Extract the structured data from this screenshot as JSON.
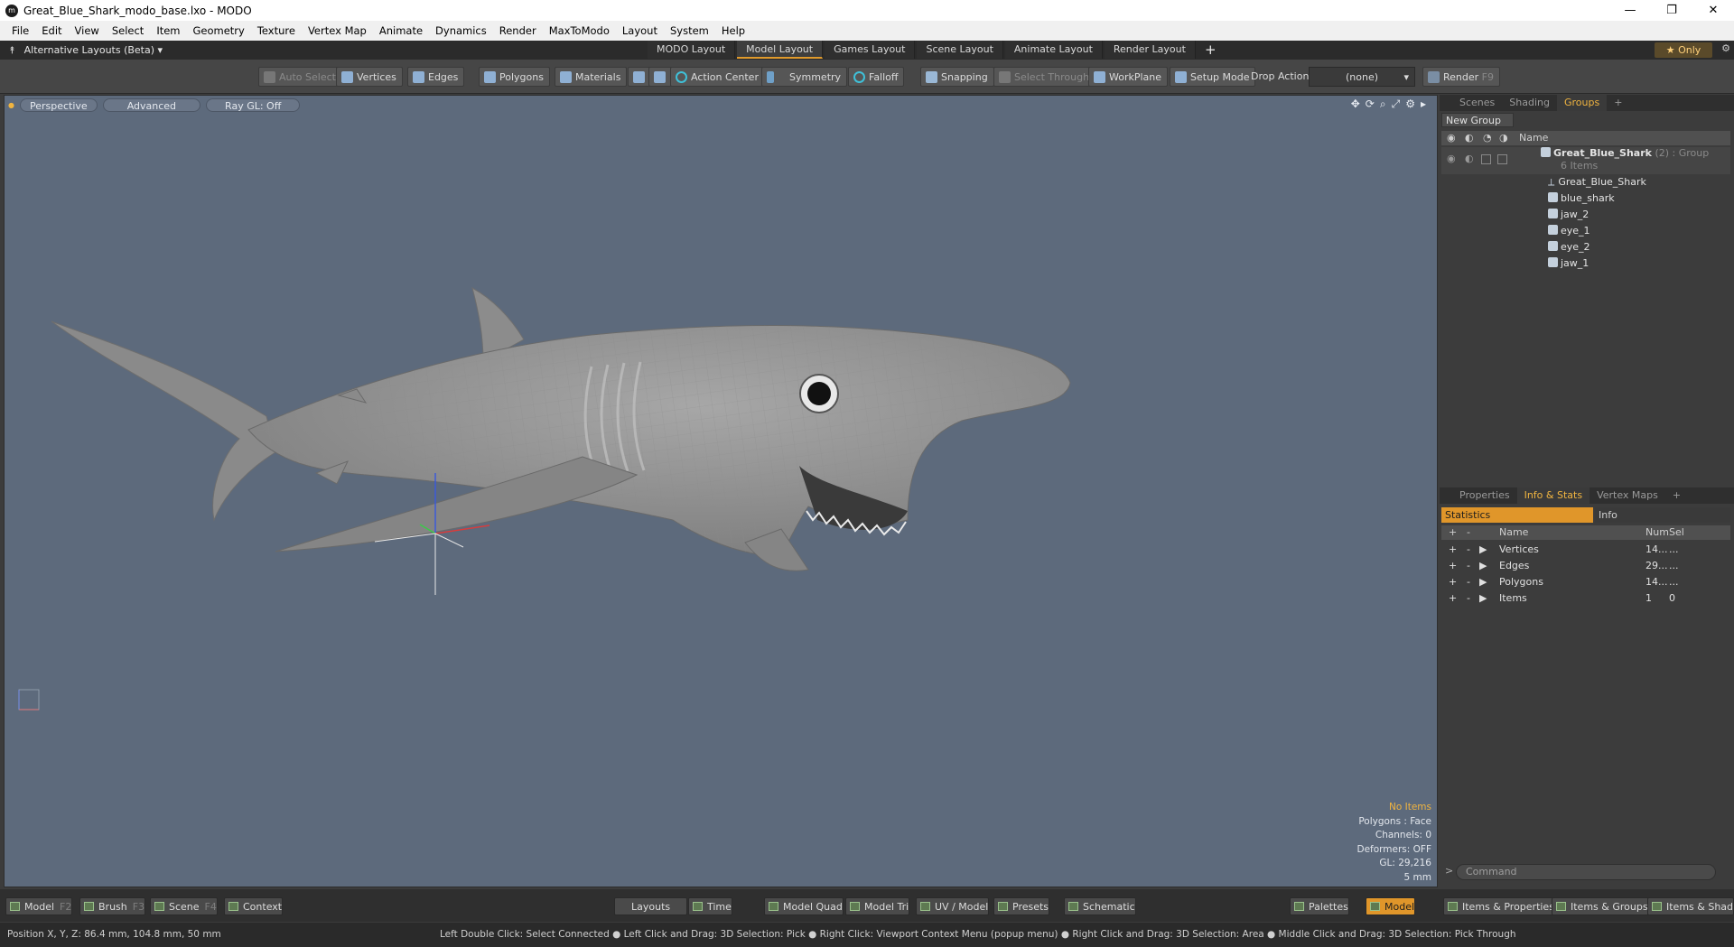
{
  "window": {
    "title": "Great_Blue_Shark_modo_base.lxo - MODO",
    "minimize": "—",
    "restore": "❐",
    "close": "✕"
  },
  "menu": [
    "File",
    "Edit",
    "View",
    "Select",
    "Item",
    "Geometry",
    "Texture",
    "Vertex Map",
    "Animate",
    "Dynamics",
    "Render",
    "MaxToModo",
    "Layout",
    "System",
    "Help"
  ],
  "layoutbar": {
    "alt_layouts": "Alternative Layouts (Beta)",
    "tabs": [
      "MODO Layout",
      "Model Layout",
      "Games Layout",
      "Scene Layout",
      "Animate Layout",
      "Render Layout"
    ],
    "active_tab": "Model Layout",
    "add": "+",
    "only": "★ Only"
  },
  "toolbar": {
    "auto_select": "Auto Select",
    "vertices": "Vertices",
    "edges": "Edges",
    "polygons": "Polygons",
    "materials": "Materials",
    "action_center": "Action Center",
    "symmetry": "Symmetry",
    "falloff": "Falloff",
    "snapping": "Snapping",
    "select_through": "Select Through",
    "workplane": "WorkPlane",
    "setup_mode": "Setup Mode",
    "drop_action_label": "Drop Action",
    "drop_action_value": "(none)",
    "render": "Render",
    "render_key": "F9"
  },
  "viewport": {
    "perspective": "Perspective",
    "advanced": "Advanced",
    "raygl": "Ray GL: Off",
    "info": {
      "no_items": "No Items",
      "polygons": "Polygons : Face",
      "channels": "Channels: 0",
      "deformers": "Deformers: OFF",
      "gl": "GL: 29,216",
      "scale": "5 mm"
    }
  },
  "groups_panel": {
    "tabs": [
      "Scenes",
      "Shading",
      "Groups"
    ],
    "active_tab": "Groups",
    "new_group": "New Group",
    "col_name": "Name",
    "root": {
      "name": "Great_Blue_Shark",
      "count": "(2) : Group",
      "items": "6 Items"
    },
    "children": [
      "Great_Blue_Shark",
      "blue_shark",
      "jaw_2",
      "eye_1",
      "eye_2",
      "jaw_1"
    ]
  },
  "info_panel": {
    "tabs": [
      "Properties",
      "Info & Stats",
      "Vertex Maps"
    ],
    "active_tab": "Info & Stats",
    "statistics": "Statistics",
    "info": "Info",
    "columns": {
      "name": "Name",
      "num": "Num",
      "sel": "Sel"
    },
    "rows": [
      {
        "name": "Vertices",
        "num": "14...",
        "sel": "..."
      },
      {
        "name": "Edges",
        "num": "29...",
        "sel": "..."
      },
      {
        "name": "Polygons",
        "num": "14...",
        "sel": "..."
      },
      {
        "name": "Items",
        "num": "1",
        "sel": "0"
      }
    ],
    "command_placeholder": "Command"
  },
  "bottombar": {
    "model": "Model",
    "model_key": "F2",
    "brush": "Brush",
    "brush_key": "F3",
    "scene": "Scene",
    "scene_key": "F4",
    "context": "Context",
    "layouts": "Layouts",
    "time": "Time",
    "model_quad": "Model Quad",
    "model_tri": "Model Tri",
    "uv_model": "UV / Model",
    "presets": "Presets",
    "schematic": "Schematic",
    "palettes": "Palettes",
    "model_active": "Model",
    "items_properties": "Items & Properties",
    "items_groups": "Items & Groups",
    "items_shading": "Items & Shading"
  },
  "statusbar": {
    "position": "Position X, Y, Z:   86.4 mm, 104.8 mm, 50 mm",
    "hints": "Left Double Click: Select Connected ● Left Click and Drag: 3D Selection: Pick ● Right Click: Viewport Context Menu (popup menu) ● Right Click and Drag: 3D Selection: Area ● Middle Click and Drag: 3D Selection: Pick Through"
  },
  "colors": {
    "accent": "#e0962a",
    "viewport_bg": "#5d6a7c",
    "panel_bg": "#3c3c3c"
  }
}
